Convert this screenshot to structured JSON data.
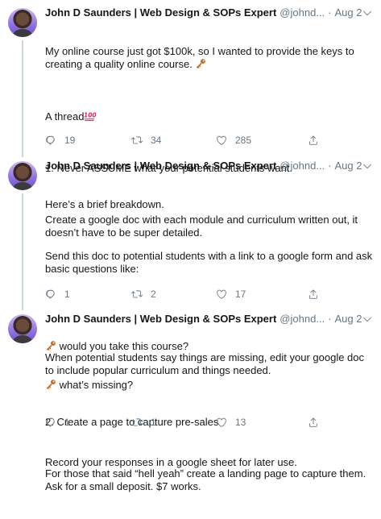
{
  "tweets": [
    {
      "author": "John D Saunders | Web Design & SOPs Expert",
      "handle": "@johnd...",
      "separator": "·",
      "date": "Aug 2",
      "paragraphs": [
        "My online course just got $100k, so I wanted to provide the keys to creating a quality online course.",
        "A thread",
        "1. Never ASSUME what your potential students want.",
        "Create a google doc with each module and curriculum written out, it doesn’t have to be super detailed."
      ],
      "replies": "19",
      "retweets": "34",
      "likes": "285"
    },
    {
      "author": "John D Saunders | Web Design & SOPs Expert",
      "handle": "@johnd...",
      "separator": "·",
      "date": "Aug 2",
      "paragraphs": [
        "Here’s a brief breakdown.",
        "Send this doc to potential students with a link to a google form and ask basic questions like:",
        "Record your responses in a google sheet for later use."
      ],
      "list_items": [
        "would you take this course?",
        "what’s missing?"
      ],
      "replies": "1",
      "retweets": "2",
      "likes": "17"
    },
    {
      "author": "John D Saunders | Web Design & SOPs Expert",
      "handle": "@johnd...",
      "separator": "·",
      "date": "Aug 2",
      "paragraphs": [
        "When potential students say things are missing, edit your google doc to include popular curriculum and things needed.",
        "2. Create a page to capture pre-sales",
        "For those that said “hell yeah” create a landing page to capture them. Ask for a small deposit. $7 works."
      ],
      "replies": "1",
      "retweets": "1",
      "likes": "13"
    }
  ],
  "icons": {
    "key": "key-icon",
    "hundred": "hundred-points-icon",
    "reply": "reply-icon",
    "retweet": "retweet-icon",
    "like": "heart-icon",
    "share": "share-icon",
    "more": "chevron-down-icon"
  },
  "colors": {
    "text": "#14171a",
    "secondary": "#657786",
    "thread_line": "#ccd6dd",
    "key": "#c46a2b",
    "hundred": "#e0245e"
  }
}
